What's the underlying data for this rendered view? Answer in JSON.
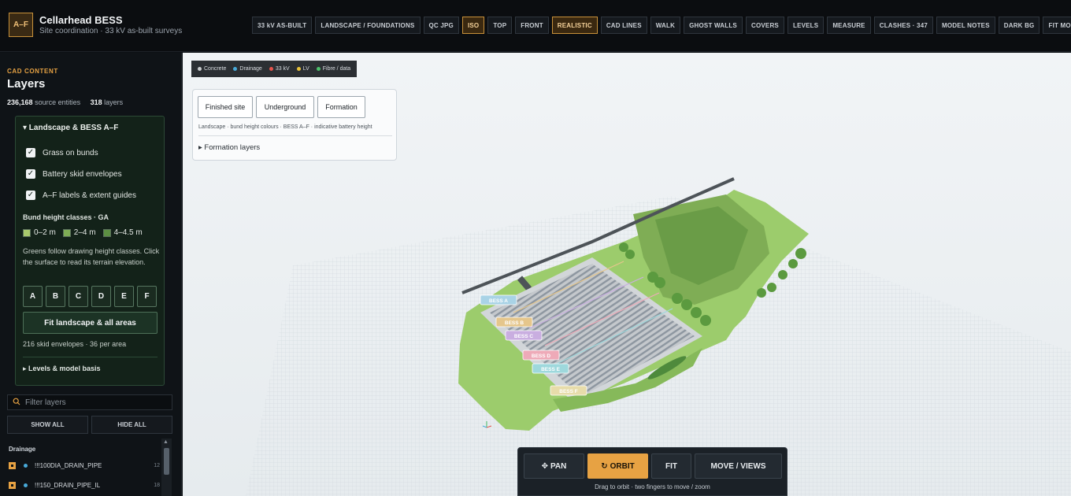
{
  "app": {
    "logo": "A–F",
    "title": "Cellarhead BESS",
    "subtitle": "Site coordination · 33 kV as-built surveys"
  },
  "toolbar": [
    {
      "label": "33 kV AS-BUILT",
      "active": false
    },
    {
      "label": "LANDSCAPE / FOUNDATIONS",
      "active": false
    },
    {
      "label": "QC JPG",
      "active": false
    },
    {
      "label": "ISO",
      "active": true
    },
    {
      "label": "TOP",
      "active": false
    },
    {
      "label": "FRONT",
      "active": false
    },
    {
      "label": "REALISTIC",
      "active": true
    },
    {
      "label": "CAD LINES",
      "active": false
    },
    {
      "label": "WALK",
      "active": false
    },
    {
      "label": "GHOST WALLS",
      "active": false
    },
    {
      "label": "COVERS",
      "active": false
    },
    {
      "label": "LEVELS",
      "active": false
    },
    {
      "label": "MEASURE",
      "active": false
    },
    {
      "label": "CLASHES · 347",
      "active": false
    },
    {
      "label": "MODEL NOTES",
      "active": false
    },
    {
      "label": "DARK BG",
      "active": false
    },
    {
      "label": "FIT MODEL",
      "active": false
    }
  ],
  "sidebar": {
    "kicker": "CAD CONTENT",
    "title": "Layers",
    "entities_count": "236,168",
    "entities_label": "source entities",
    "layers_count": "318",
    "layers_label": "layers",
    "panel": {
      "heading": "▾ Landscape & BESS A–F",
      "checks": [
        {
          "label": "Grass on bunds",
          "checked": true
        },
        {
          "label": "Battery skid envelopes",
          "checked": true
        },
        {
          "label": "A–F labels & extent guides",
          "checked": true
        }
      ],
      "bund_title": "Bund height classes · GA",
      "bund_classes": [
        {
          "label": "0–2 m",
          "color": "#a8c96c"
        },
        {
          "label": "2–4 m",
          "color": "#7fad55"
        },
        {
          "label": "4–4.5 m",
          "color": "#5c8f42"
        }
      ],
      "note": "Greens follow drawing height classes. Click the surface to read its terrain elevation.",
      "areas": [
        "A",
        "B",
        "C",
        "D",
        "E",
        "F"
      ],
      "fit_label": "Fit landscape & all areas",
      "skid_note": "216 skid envelopes · 36 per area",
      "levels_label": "▸ Levels & model basis"
    },
    "filter_placeholder": "Filter layers",
    "show_all": "SHOW ALL",
    "hide_all": "HIDE ALL",
    "group": "Drainage",
    "layers": [
      {
        "name": "!!!100DIA_DRAIN_PIPE",
        "count": "12",
        "color": "#48a9d8"
      },
      {
        "name": "!!!150_DRAIN_PIPE_IL",
        "count": "18",
        "color": "#48a9d8"
      }
    ]
  },
  "viewport": {
    "legend": [
      {
        "label": "Concrete",
        "color": "#c9ccce"
      },
      {
        "label": "Drainage",
        "color": "#48a9d8"
      },
      {
        "label": "33 kV",
        "color": "#e5534b"
      },
      {
        "label": "LV",
        "color": "#e8c23a"
      },
      {
        "label": "Fibre / data",
        "color": "#4cc06a"
      }
    ],
    "modes": [
      "Finished site",
      "Underground",
      "Formation"
    ],
    "mode_note": "Landscape · bund height colours · BESS A–F · indicative battery height",
    "formation_label": "▸ Formation layers",
    "bess_labels": [
      {
        "label": "BESS A",
        "color": "#a9d3e6"
      },
      {
        "label": "BESS B",
        "color": "#e5c68c"
      },
      {
        "label": "BESS C",
        "color": "#c9aee0"
      },
      {
        "label": "BESS D",
        "color": "#eeaab8"
      },
      {
        "label": "BESS E",
        "color": "#9ed8dc"
      },
      {
        "label": "BESS F",
        "color": "#e7dcaa"
      }
    ]
  },
  "controls": {
    "pan": "PAN",
    "orbit": "ORBIT",
    "fit": "FIT",
    "move_views": "MOVE / VIEWS",
    "hint": "Drag to orbit · two fingers to move / zoom"
  },
  "colors": {
    "accent": "#e7a243",
    "panel_green": "#132219",
    "grass": "#9ccc6c"
  }
}
